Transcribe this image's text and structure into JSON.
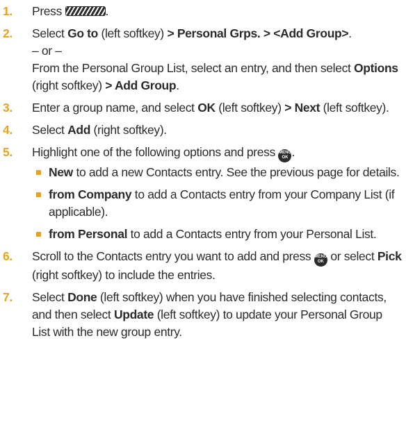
{
  "steps": [
    {
      "num": "1",
      "t1": "Press "
    },
    {
      "num": "2",
      "t1": "Select ",
      "b1": "Go to",
      "t2": " (left softkey) ",
      "b2": "> Personal Grps. > <Add Group>",
      "t3": ".",
      "or": "– or –",
      "alt1": "From the Personal Group List, select an entry, and then select ",
      "alt_b1": "Options",
      "alt2": " (right softkey) ",
      "alt_b2": "> Add Group",
      "alt3": "."
    },
    {
      "num": "3",
      "t1": "Enter a group name, and select ",
      "b1": "OK",
      "t2": " (left softkey) ",
      "b2": "> Next",
      "t3": " (left softkey)."
    },
    {
      "num": "4",
      "t1": "Select ",
      "b1": "Add",
      "t2": " (right softkey)."
    },
    {
      "num": "5",
      "t1": "Highlight one of the following options and press ",
      "t2": ".",
      "bullets": [
        {
          "b": "New",
          "t": " to add a new Contacts entry. See the previous page for details."
        },
        {
          "b": "from Company",
          "t": " to add a Contacts entry from your Company List (if applicable)."
        },
        {
          "b": "from Personal",
          "t": " to add a Contacts entry from your Personal List."
        }
      ]
    },
    {
      "num": "6",
      "t1": "Scroll to the Contacts entry you want to add and press ",
      "t2": " or select ",
      "b1": "Pick",
      "t3": " (right softkey) to include the entries."
    },
    {
      "num": "7",
      "t1": "Select ",
      "b1": "Done",
      "t2": " (left softkey) when you have finished selecting contacts, and then select ",
      "b2": "Update",
      "t3": " (left softkey) to update your Personal Group List with the new group entry."
    }
  ],
  "menu_key": {
    "line1": "MENU",
    "line2": "OK"
  },
  "colors": {
    "accent": "#e8a41c",
    "text": "#2b2b2b"
  },
  "icons": {
    "back_key": "striped-key-icon",
    "menu_ok_key": "menu-ok-key-icon"
  }
}
